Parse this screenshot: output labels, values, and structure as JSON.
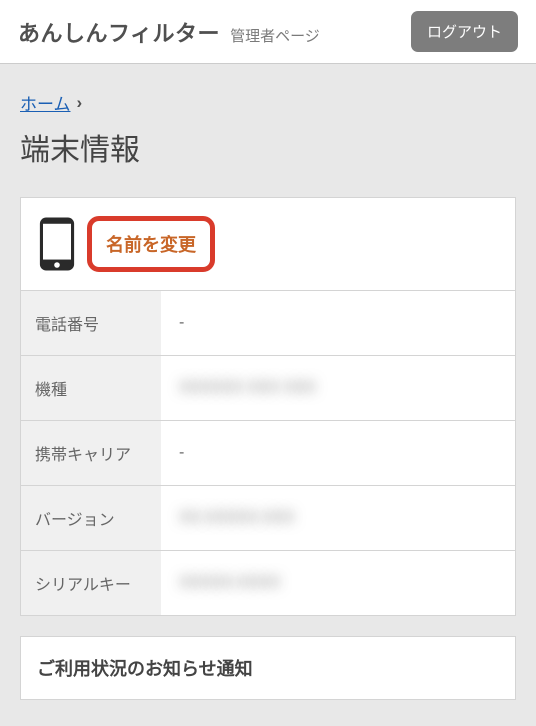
{
  "header": {
    "logo": "あんしんフィルター",
    "subtitle": "管理者ページ",
    "logout": "ログアウト"
  },
  "breadcrumb": {
    "home": "ホーム",
    "sep": "›"
  },
  "page_title": "端末情報",
  "device": {
    "rename_label": "名前を変更"
  },
  "rows": [
    {
      "label": "電話番号",
      "value": "-",
      "blurred": false
    },
    {
      "label": "機種",
      "value": "XXXXXX XXX XXX",
      "blurred": true
    },
    {
      "label": "携帯キャリア",
      "value": "-",
      "blurred": false
    },
    {
      "label": "バージョン",
      "value": "XX.XXXXX.XXX",
      "blurred": true
    },
    {
      "label": "シリアルキー",
      "value": "XXXXX-XXXX",
      "blurred": true
    }
  ],
  "notice_title": "ご利用状況のお知らせ通知"
}
